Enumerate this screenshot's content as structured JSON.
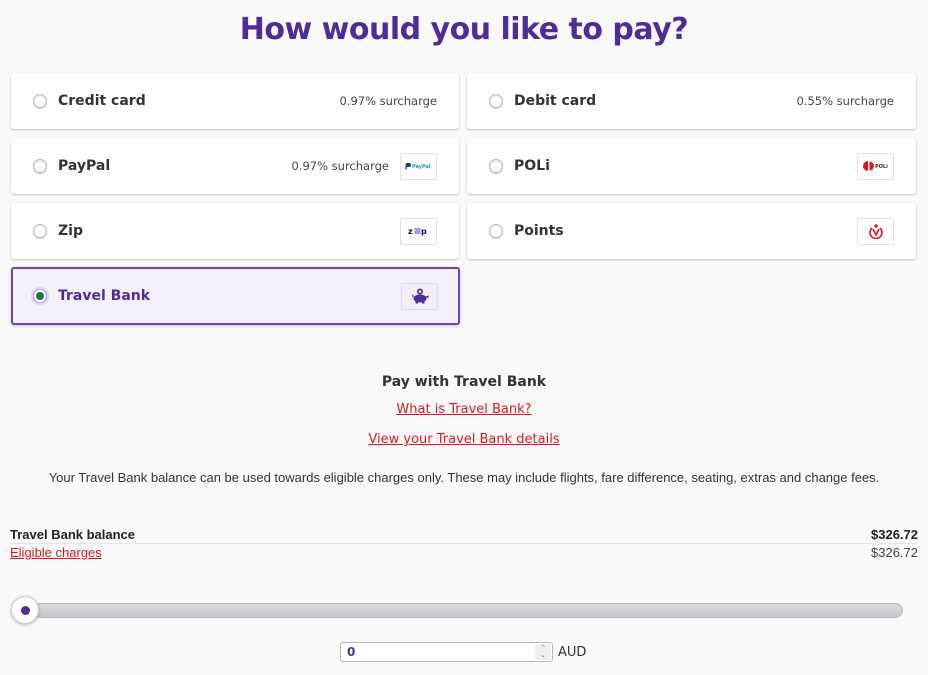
{
  "page": {
    "title": "How would you like to pay?"
  },
  "payment_options": [
    {
      "id": "credit-card",
      "label": "Credit card",
      "surcharge": "0.97% surcharge",
      "logo": null,
      "selected": false
    },
    {
      "id": "debit-card",
      "label": "Debit card",
      "surcharge": "0.55% surcharge",
      "logo": null,
      "selected": false
    },
    {
      "id": "paypal",
      "label": "PayPal",
      "surcharge": "0.97% surcharge",
      "logo": "paypal-logo",
      "logo_text": "PayPal",
      "selected": false
    },
    {
      "id": "poli",
      "label": "POLi",
      "surcharge": null,
      "logo": "poli-logo",
      "logo_text": "POLi",
      "selected": false
    },
    {
      "id": "zip",
      "label": "Zip",
      "surcharge": null,
      "logo": "zip-logo",
      "logo_text": "zip",
      "selected": false
    },
    {
      "id": "points",
      "label": "Points",
      "surcharge": null,
      "logo": "velocity-points-icon",
      "selected": false
    },
    {
      "id": "travel-bank",
      "label": "Travel Bank",
      "surcharge": null,
      "logo": "piggy-bank-icon",
      "selected": true
    }
  ],
  "travel_bank": {
    "heading": "Pay with Travel Bank",
    "what_is_link": "What is Travel Bank?",
    "view_details_link": "View your Travel Bank details",
    "description": "Your Travel Bank balance can be used towards eligible charges only. These may include flights, fare difference, seating, extras and change fees.",
    "balance_label": "Travel Bank balance",
    "balance_value": "$326.72",
    "eligible_label": "Eligible charges",
    "eligible_value": "$326.72",
    "slider": {
      "min": 0,
      "max": 326.72,
      "value": 0
    },
    "amount_input_value": "0",
    "currency": "AUD"
  },
  "colors": {
    "brand_purple": "#4f2c96",
    "link_red": "#e0161f",
    "selected_radio": "#1b7a3a",
    "selected_card_bg": "#f4f0f9"
  }
}
